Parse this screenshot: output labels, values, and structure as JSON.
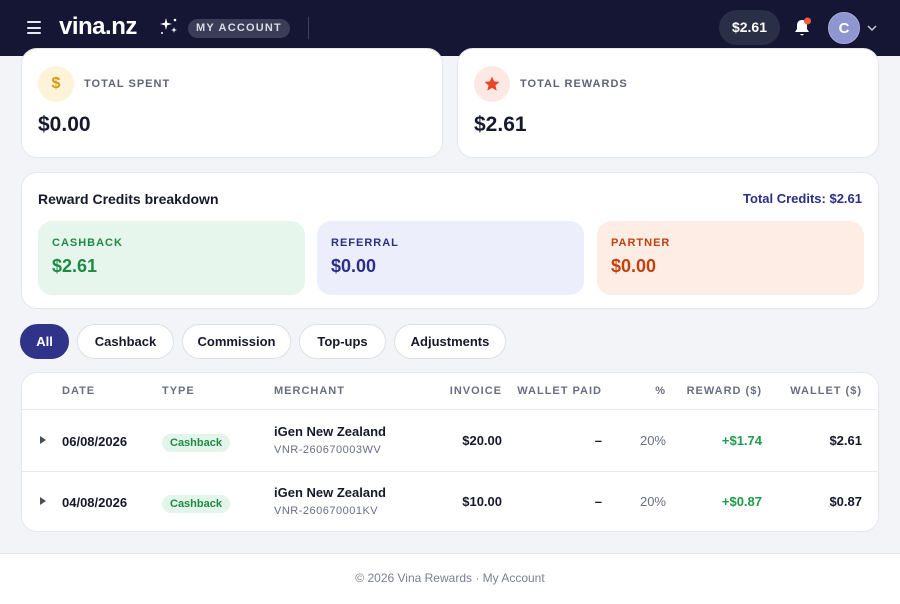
{
  "header": {
    "logo_text": "vina.nz",
    "account_label": "MY ACCOUNT",
    "balance": "$2.61",
    "avatar_initial": "C",
    "notification_dot_color": "#ff5a3c"
  },
  "stats": [
    {
      "label": "TOTAL SPENT",
      "value": "$0.00",
      "icon": "dollar-icon",
      "icon_glyph": "$"
    },
    {
      "label": "TOTAL REWARDS",
      "value": "$2.61",
      "icon": "star-icon"
    }
  ],
  "breakdown": {
    "title": "Reward Credits breakdown",
    "total": "Total Credits: $2.61",
    "credits": [
      {
        "label": "CASHBACK",
        "value": "$2.61",
        "bg": "#e6f6ec",
        "color": "#1f8a44"
      },
      {
        "label": "REFERRAL",
        "value": "$0.00",
        "bg": "#eceefb",
        "color": "#2b2f86"
      },
      {
        "label": "PARTNER",
        "value": "$0.00",
        "bg": "#fdede4",
        "color": "#c2410c"
      }
    ]
  },
  "filters": [
    "All",
    "Cashback",
    "Commission",
    "Top-ups",
    "Adjustments"
  ],
  "table": {
    "columns": [
      "DATE",
      "TYPE",
      "MERCHANT",
      "INVOICE",
      "WALLET PAID",
      "%",
      "REWARD ($)",
      "WALLET ($)"
    ],
    "rows": [
      {
        "date": "06/08/2026",
        "type": "Cashback",
        "merchant": "iGen New Zealand",
        "ref": "VNR-260670003WV",
        "invoice": "$20.00",
        "wallet_paid": "–",
        "percent": "20%",
        "reward": "+$1.74",
        "wallet": "$2.61"
      },
      {
        "date": "04/08/2026",
        "type": "Cashback",
        "merchant": "iGen New Zealand",
        "ref": "VNR-260670001KV",
        "invoice": "$10.00",
        "wallet_paid": "–",
        "percent": "20%",
        "reward": "+$0.87",
        "wallet": "$0.87"
      }
    ]
  },
  "footer": "© 2026 Vina Rewards · My Account"
}
